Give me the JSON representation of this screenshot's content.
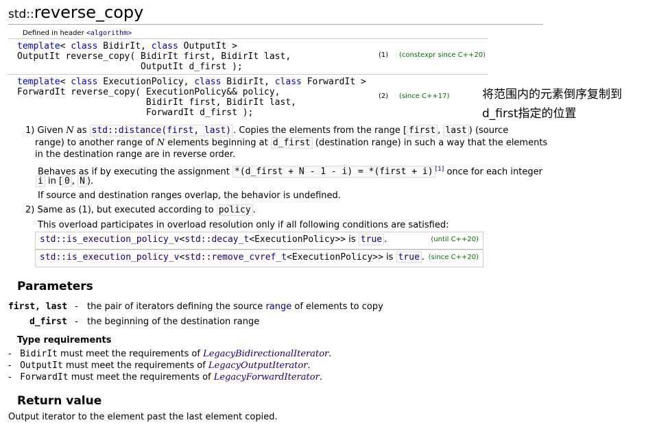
{
  "title": {
    "ns": "std::",
    "name": "reverse_copy"
  },
  "header": {
    "prefix": "Defined in header ",
    "name": "<algorithm>"
  },
  "signatures": [
    {
      "line1_kw1": "template",
      "line1_rest1": "< ",
      "line1_kw2": "class",
      "line1_rest2": " BidirIt, ",
      "line1_kw3": "class",
      "line1_rest3": " OutputIt >",
      "line2": "OutputIt reverse_copy( BidirIt first, BidirIt last,",
      "line3": "                       OutputIt d_first );",
      "num": "(1)",
      "note": "(constexpr since C++20)"
    },
    {
      "line1_kw1": "template",
      "line1_rest1": "< ",
      "line1_kw2": "class",
      "line1_rest2": " ExecutionPolicy, ",
      "line1_kw3": "class",
      "line1_rest3": " BidirIt, ",
      "line1_kw4": "class",
      "line1_rest4": " ForwardIt >",
      "line2": "ForwardIt reverse_copy( ExecutionPolicy&& policy,",
      "line3": "                        BidirIt first, BidirIt last,",
      "line4": "                        ForwardIt d_first );",
      "num": "(2)",
      "note": "(since C++17)"
    }
  ],
  "annotation": {
    "line1": "将范围内的元素倒序复制到",
    "line2": "d_first指定的位置"
  },
  "desc1": {
    "p1a": "1) Given ",
    "N": "N",
    "p1b": " as ",
    "distance": "std::distance(first, last)",
    "p1c": ". Copies the elements from the range [",
    "first": "first",
    "comma": ", ",
    "last": "last",
    "p1d": ") (source",
    "p2": "range) to another range of ",
    "p2b": " elements beginning at ",
    "dfirst": "d_first",
    "p2c": " (destination range) in such a way that the elements",
    "p3": "in the destination range are in reverse order.",
    "p4a": "Behaves as if by executing the assignment ",
    "assign": "*(d_first + N - 1 - i) = *(first + i)",
    "ref": "[1]",
    "p4b": " once for each integer",
    "p5_i": "i",
    "p5_in": " in [",
    "p5_zero": "0",
    "p5_comma": ", ",
    "p5_N": "N",
    "p5_end": ").",
    "p6": "If source and destination ranges overlap, the behavior is undefined."
  },
  "desc2": {
    "p1a": "2) Same as (1), but executed according to ",
    "policy": "policy",
    "p1b": ".",
    "p2": "This overload participates in overload resolution only if all following conditions are satisfied:",
    "cond1": {
      "a": "std::is_execution_policy_v",
      "b": "<",
      "c": "std::decay_t",
      "d": "<ExecutionPolicy>>",
      "e": " is ",
      "f": "true",
      "g": ".",
      "note": "(until C++20)"
    },
    "cond2": {
      "a": "std::is_execution_policy_v",
      "b": "<",
      "c": "std::remove_cvref_t",
      "d": "<ExecutionPolicy>>",
      "e": " is ",
      "f": "true",
      "g": ".",
      "note": "(since C++20)"
    }
  },
  "parameters": {
    "heading": "Parameters",
    "p1_name": "first, last",
    "p1_dash": "-",
    "p1_a": "the pair of iterators defining the source ",
    "p1_link": "range",
    "p1_b": " of elements to copy",
    "p2_name": "d_first",
    "p2_dash": "-",
    "p2_text": "the beginning of the destination range"
  },
  "type_req": {
    "heading": "Type requirements",
    "items": [
      {
        "dash": "-",
        "type": "BidirIt",
        "text": " must meet the requirements of ",
        "link": "LegacyBidirectionalIterator",
        "end": "."
      },
      {
        "dash": "-",
        "type": "OutputIt",
        "text": " must meet the requirements of ",
        "link": "LegacyOutputIterator",
        "end": "."
      },
      {
        "dash": "-",
        "type": "ForwardIt",
        "text": " must meet the requirements of ",
        "link": "LegacyForwardIterator",
        "end": "."
      }
    ]
  },
  "return_value": {
    "heading": "Return value",
    "text": "Output iterator to the element past the last element copied."
  }
}
